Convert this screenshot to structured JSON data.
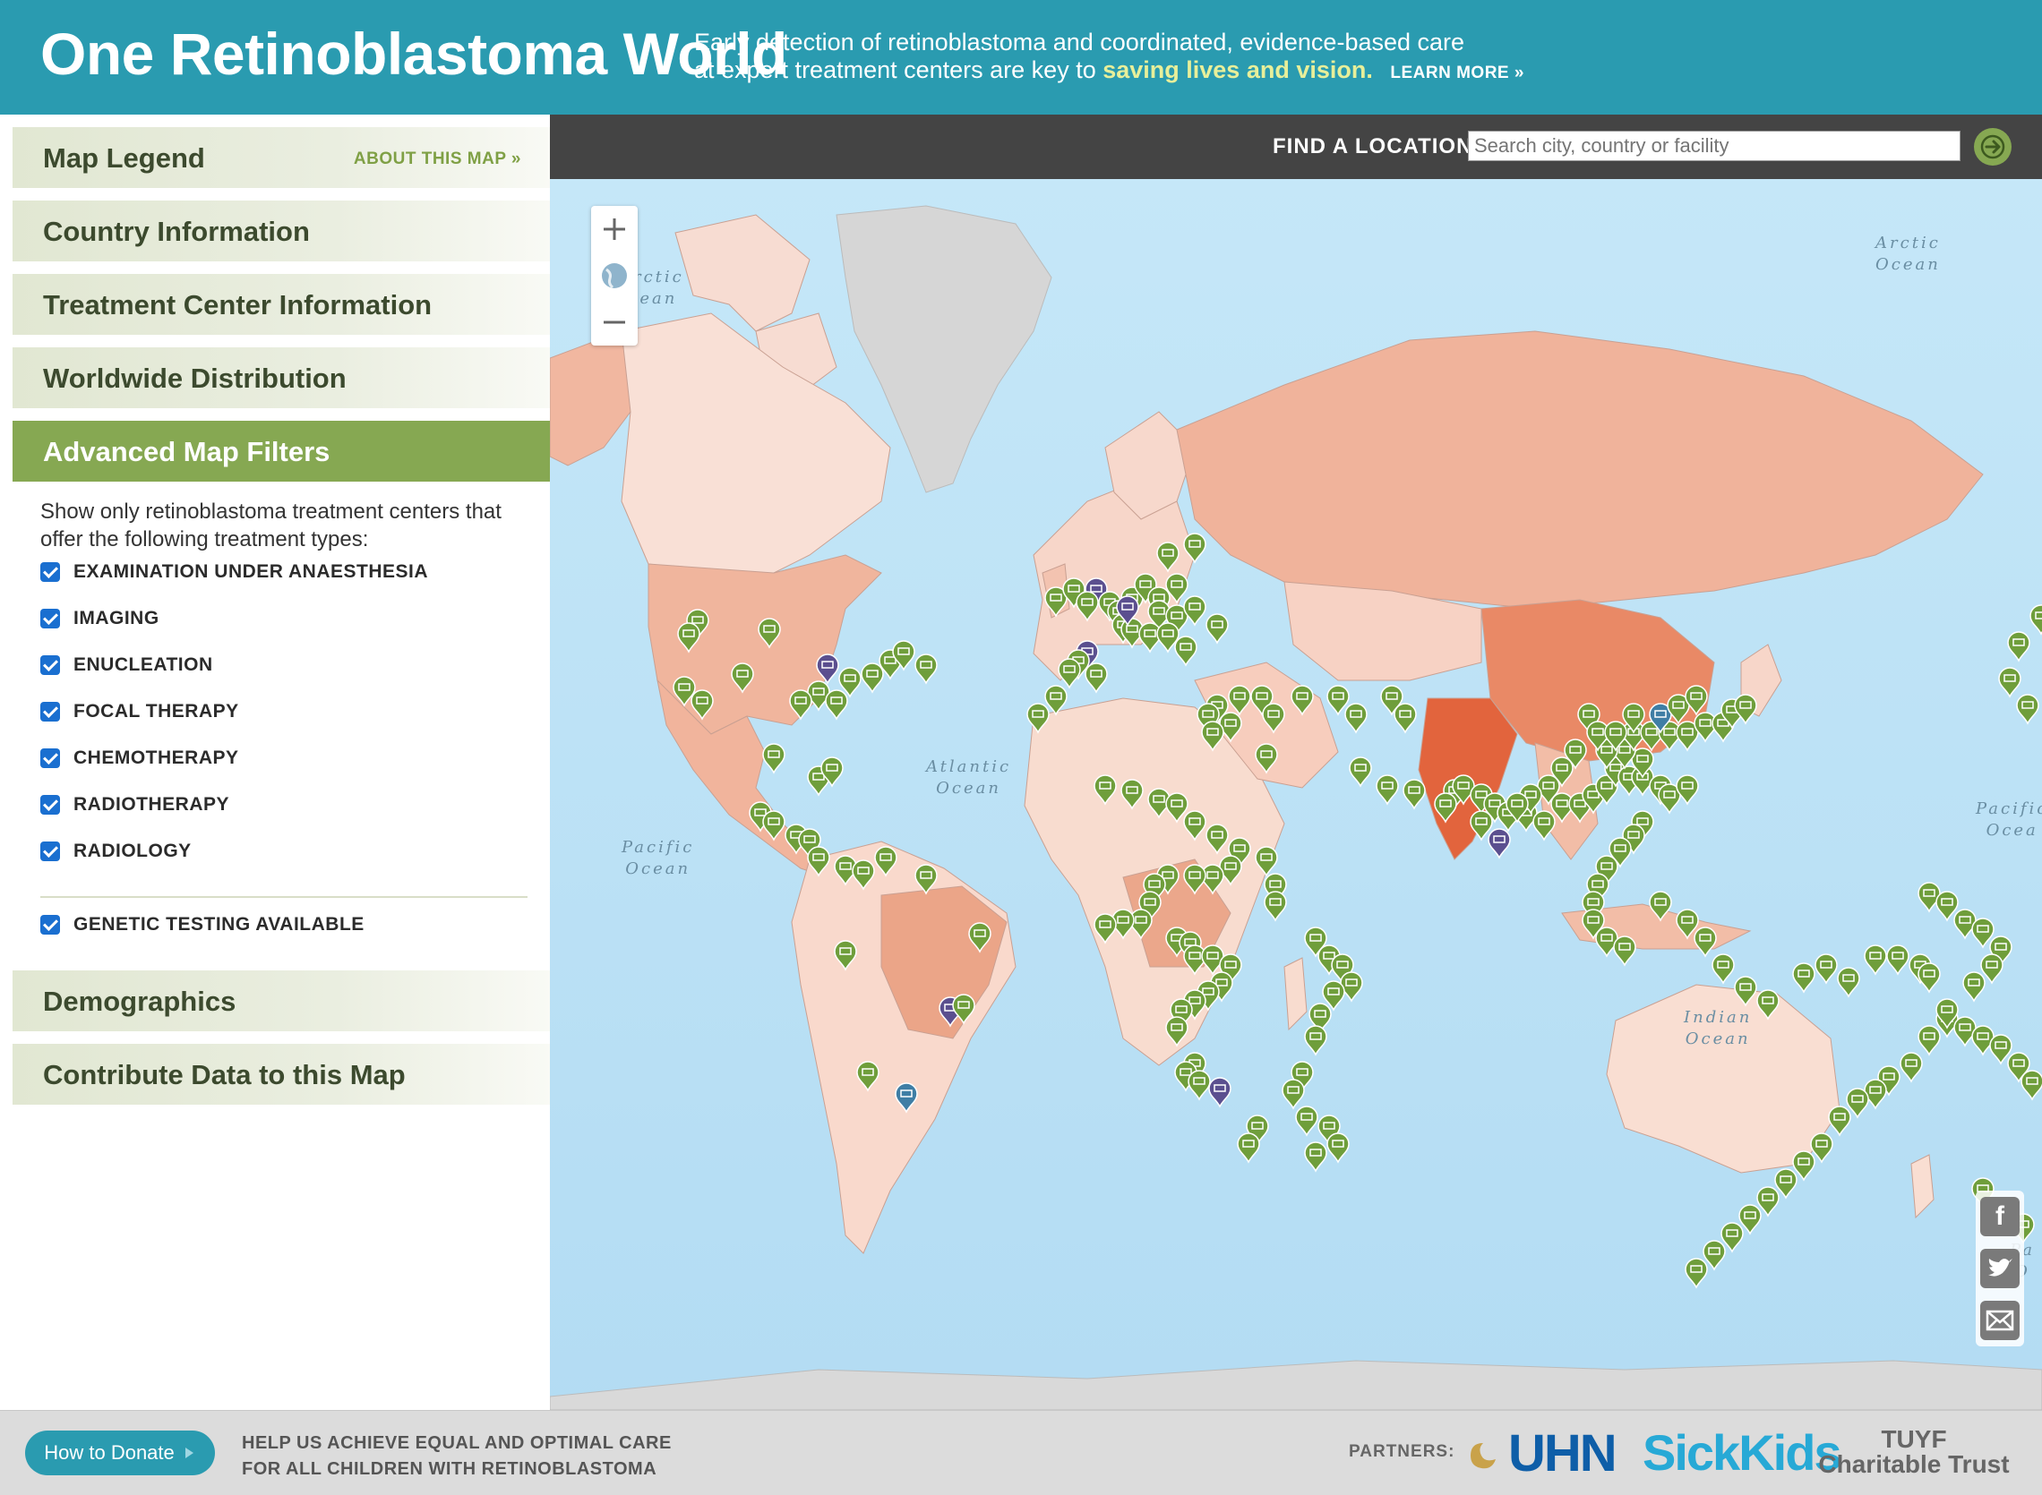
{
  "header": {
    "title": "One Retinoblastoma World",
    "tagline_line1": "Early detection of retinoblastoma and coordinated, evidence-based care",
    "tagline_line2": "at expert treatment centers are key to",
    "tagline_highlight": "saving lives and vision.",
    "learn_more": "LEARN MORE »",
    "background_color": "#2a9bb0",
    "highlight_color": "#e7ef9a"
  },
  "sidebar": {
    "sections": [
      {
        "label": "Map Legend",
        "link": "ABOUT THIS MAP »"
      },
      {
        "label": "Country Information"
      },
      {
        "label": "Treatment Center Information"
      },
      {
        "label": "Worldwide Distribution"
      },
      {
        "label": "Advanced Map Filters",
        "active": true
      },
      {
        "label": "Demographics"
      },
      {
        "label": "Contribute Data to this Map"
      }
    ],
    "active_color": "#86a852",
    "filters": {
      "intro": "Show only retinoblastoma treatment centers that offer the following treatment types:",
      "options": [
        {
          "label": "EXAMINATION UNDER ANAESTHESIA",
          "checked": true
        },
        {
          "label": "IMAGING",
          "checked": true
        },
        {
          "label": "ENUCLEATION",
          "checked": true
        },
        {
          "label": "FOCAL THERAPY",
          "checked": true
        },
        {
          "label": "CHEMOTHERAPY",
          "checked": true
        },
        {
          "label": "RADIOTHERAPY",
          "checked": true
        },
        {
          "label": "RADIOLOGY",
          "checked": true
        }
      ],
      "genetic": {
        "label": "GENETIC TESTING AVAILABLE",
        "checked": true
      }
    }
  },
  "search": {
    "label": "FIND A LOCATION",
    "placeholder": "Search city, country or facility",
    "go_icon": "arrow-right-icon"
  },
  "map": {
    "ocean_labels": [
      "rctic\nean",
      "Arctic\nOcean",
      "Atlantic\nOcean",
      "Pacific\nOcean",
      "Pacific\nOcea",
      "Indian\nOcean",
      "Pa\nO"
    ],
    "zoom_controls": [
      "zoom-in-icon",
      "globe-icon",
      "zoom-out-icon"
    ],
    "social": [
      "facebook-icon",
      "twitter-icon",
      "email-icon"
    ],
    "marker_types": {
      "treatment_center": "#6f9e3b",
      "research_center": "#5b4f8f",
      "genetic_testing": "#3f7ea5"
    },
    "ocean_color": "#b9e0f5"
  },
  "footer": {
    "donate_label": "How to Donate",
    "message_line1": "HELP US ACHIEVE EQUAL AND OPTIMAL CARE",
    "message_line2": "FOR ALL CHILDREN WITH RETINOBLASTOMA",
    "partners_label": "PARTNERS:",
    "partner_uhn": "UHN",
    "partner_sickkids": "SickKids",
    "partner_tuyf_line1": "TUYF",
    "partner_tuyf_line2": "Charitable Trust"
  }
}
